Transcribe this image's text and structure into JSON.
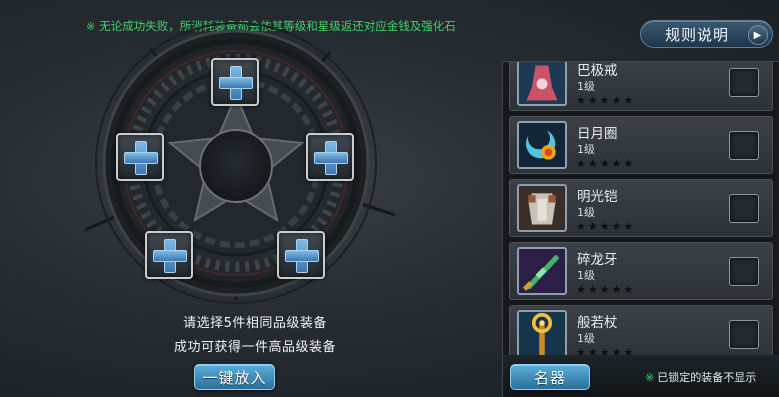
{
  "notice": {
    "mark": "※",
    "text": "无论成功失败，所消耗装备都会依其等级和星级返还对应金钱及强化石"
  },
  "rules_button": {
    "label": "规则说明",
    "arrow": "▶"
  },
  "forge": {
    "hint_line1": "请选择5件相同品级装备",
    "hint_line2": "成功可获得一件高品级装备",
    "auto_place_label": "一键放入"
  },
  "equipment_list": {
    "items": [
      {
        "name": "巴极戒",
        "level": "1级",
        "stars": "★★★★★",
        "icon": "robe-icon"
      },
      {
        "name": "日月圈",
        "level": "1级",
        "stars": "★★★★★",
        "icon": "sun-moon-ring-icon"
      },
      {
        "name": "明光铠",
        "level": "1级",
        "stars": "★★★★★",
        "icon": "armor-icon"
      },
      {
        "name": "碎龙牙",
        "level": "1级",
        "stars": "★★★★★",
        "icon": "dragon-blade-icon"
      },
      {
        "name": "般若杖",
        "level": "1级",
        "stars": "★★★★★",
        "icon": "staff-icon"
      }
    ]
  },
  "footer": {
    "category_button": "名器",
    "locked_mark": "※",
    "locked_note": "已锁定的装备不显示"
  },
  "colors": {
    "notice_green": "#44d06a",
    "button_blue": "#3a8cc0",
    "plus_blue": "#5a9fd4"
  }
}
